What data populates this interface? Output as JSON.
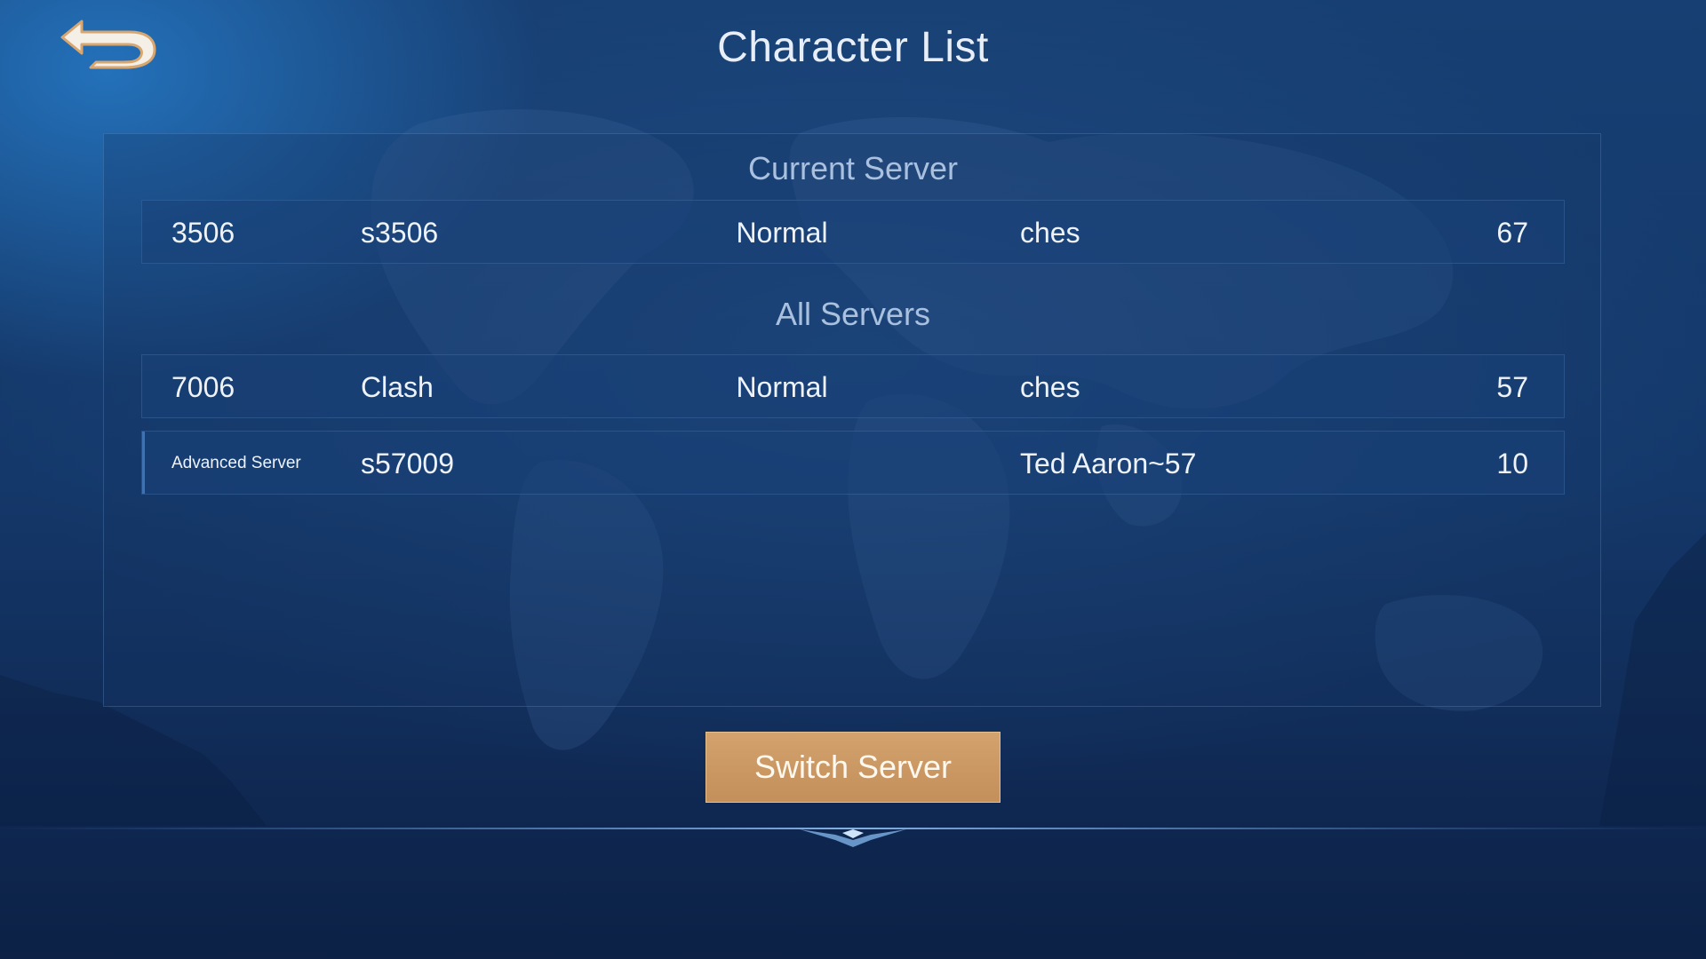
{
  "title": "Character List",
  "back_icon": "back-arrow-icon",
  "current_server": {
    "heading": "Current Server",
    "rows": [
      {
        "id": "3506",
        "name": "s3506",
        "status": "Normal",
        "character": "ches",
        "level": "67"
      }
    ]
  },
  "all_servers": {
    "heading": "All Servers",
    "rows": [
      {
        "id": "7006",
        "name": "Clash",
        "status": "Normal",
        "character": "ches",
        "level": "57"
      },
      {
        "id": "Advanced Server",
        "name": "s57009",
        "status": "",
        "character": "Ted Aaron~57",
        "level": "10"
      }
    ]
  },
  "switch_button": "Switch Server",
  "colors": {
    "button": "#c9975f",
    "background": "#143866",
    "title_text": "#e8eef7",
    "section_text": "#a9c1de"
  }
}
